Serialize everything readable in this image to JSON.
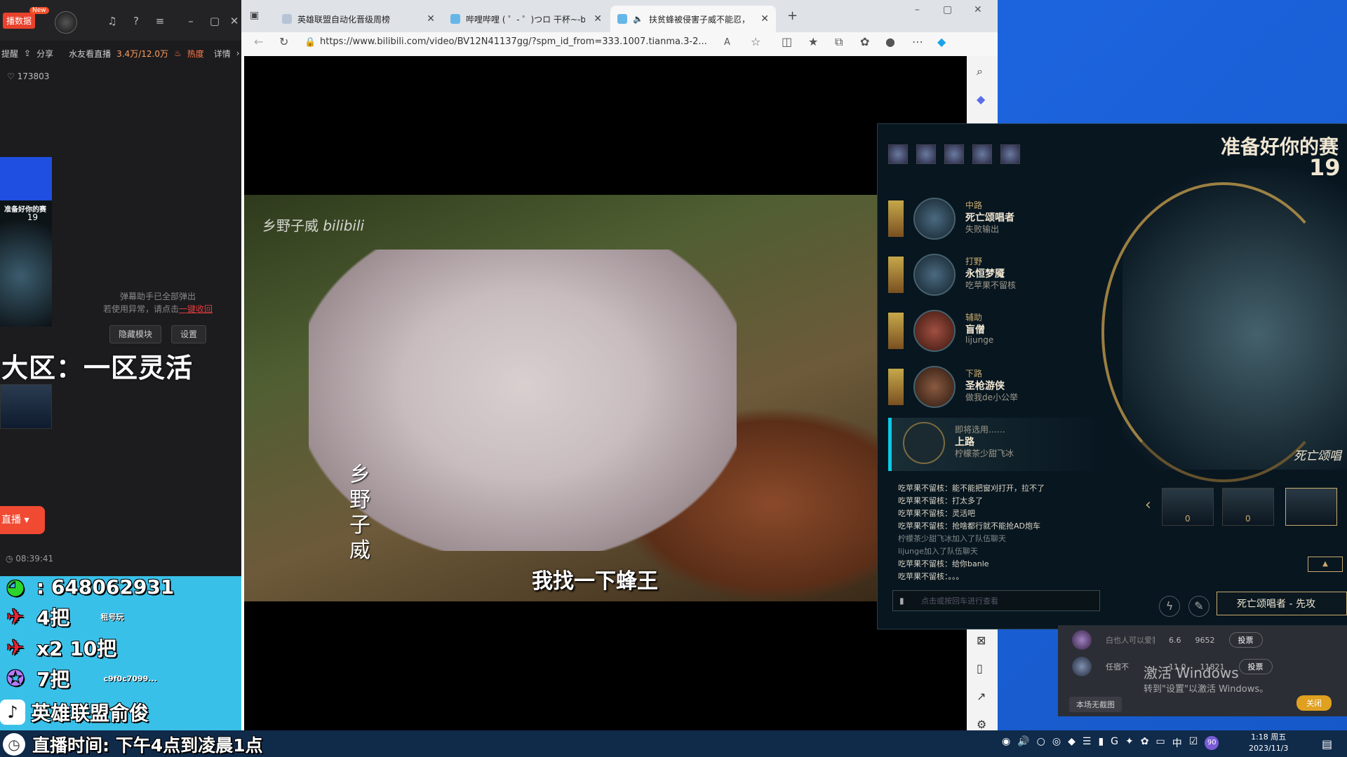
{
  "live_app": {
    "tag": "播数据",
    "new_badge": "New",
    "remind": "提醒",
    "share": "分享",
    "watch_label": "水友看直播",
    "viewer_count": "3.4万/12.0万",
    "heat": "热度",
    "detail": "详情",
    "likes": "173803",
    "thumb_title": "准备好你的赛",
    "thumb_num": "19",
    "danmu_line1": "弹幕助手已全部弹出",
    "danmu_line2": "若使用异常，请点击",
    "danmu_link": "一键收回",
    "hide_module": "隐藏模块",
    "settings": "设置",
    "region": "大区：一区灵活",
    "go_live": "直播",
    "time": "08:39:41"
  },
  "overlay": {
    "qq": ": 648062931",
    "games_4": "4把",
    "games_x2": "x2 10把",
    "games_7": "7把",
    "small_label_1": "租号玩",
    "small_label_2": "c9f0c7099...",
    "tiktok": "英雄联盟俞俊",
    "live_hours": "直播时间: 下午4点到凌晨1点"
  },
  "browser": {
    "tabs": [
      {
        "label": "英雄联盟自动化晋级周榜"
      },
      {
        "label": "哔哩哔哩 ( ゜- ゜)つロ 干杯~-bilib"
      },
      {
        "label": "扶贫蜂被侵害子威不能忍，"
      }
    ],
    "url": "https://www.bilibili.com/video/BV12N41137gg/?spm_id_from=333.1007.tianma.3-2..."
  },
  "video": {
    "watermark": "乡野子威",
    "subtitle": "我找一下蜂王",
    "vertical_text": "乡野子威"
  },
  "lol": {
    "ready_title": "准备好你的赛",
    "timer": "19",
    "picks": [
      {
        "role": "中路",
        "champion": "死亡颂唱者",
        "player": "失败输出"
      },
      {
        "role": "打野",
        "champion": "永恒梦魇",
        "player": "吃苹果不留核"
      },
      {
        "role": "辅助",
        "champion": "盲僧",
        "player": "lijunge"
      },
      {
        "role": "下路",
        "champion": "圣枪游侠",
        "player": "做我de小公举"
      },
      {
        "role": "即将选用……",
        "champion": "上路",
        "player": "柠檬茶少甜飞冰"
      }
    ],
    "chat": [
      {
        "text": "吃苹果不留核：能不能把窗刈打开，拉不了",
        "sys": false
      },
      {
        "text": "吃苹果不留核：打太多了",
        "sys": false
      },
      {
        "text": "吃苹果不留核：灵活吧",
        "sys": false
      },
      {
        "text": "吃苹果不留核：抢啥都行就不能抢AD炮车",
        "sys": false
      },
      {
        "text": "柠檬茶少甜飞冰加入了队伍聊天",
        "sys": true
      },
      {
        "text": "lijunge加入了队伍聊天",
        "sys": true
      },
      {
        "text": "吃苹果不留核：给你banle",
        "sys": false
      },
      {
        "text": "吃苹果不留核：。。。",
        "sys": false
      }
    ],
    "chat_placeholder": "点击或按回车进行查看",
    "enter_key": "回车",
    "skin_name": "死亡颂唱",
    "skin_lock_1": "0",
    "skin_lock_2": "0",
    "lock_champion": "死亡颂唱者 - 先攻"
  },
  "watchlist": {
    "row1": {
      "name": "白也人可以爱我",
      "a": "6.6",
      "b": "9652",
      "btn": "投票"
    },
    "row2": {
      "name": "任宿不",
      "a": "11.0",
      "b": "11821",
      "btn": "投票"
    },
    "no_screenshot": "本场无截图",
    "close": "关闭"
  },
  "windows": {
    "activate_title": "激活 Windows",
    "activate_sub": "转到\"设置\"以激活 Windows。",
    "tray_time": "1:18 周五",
    "tray_date": "2023/11/3",
    "ime": "中",
    "badge": "90"
  }
}
